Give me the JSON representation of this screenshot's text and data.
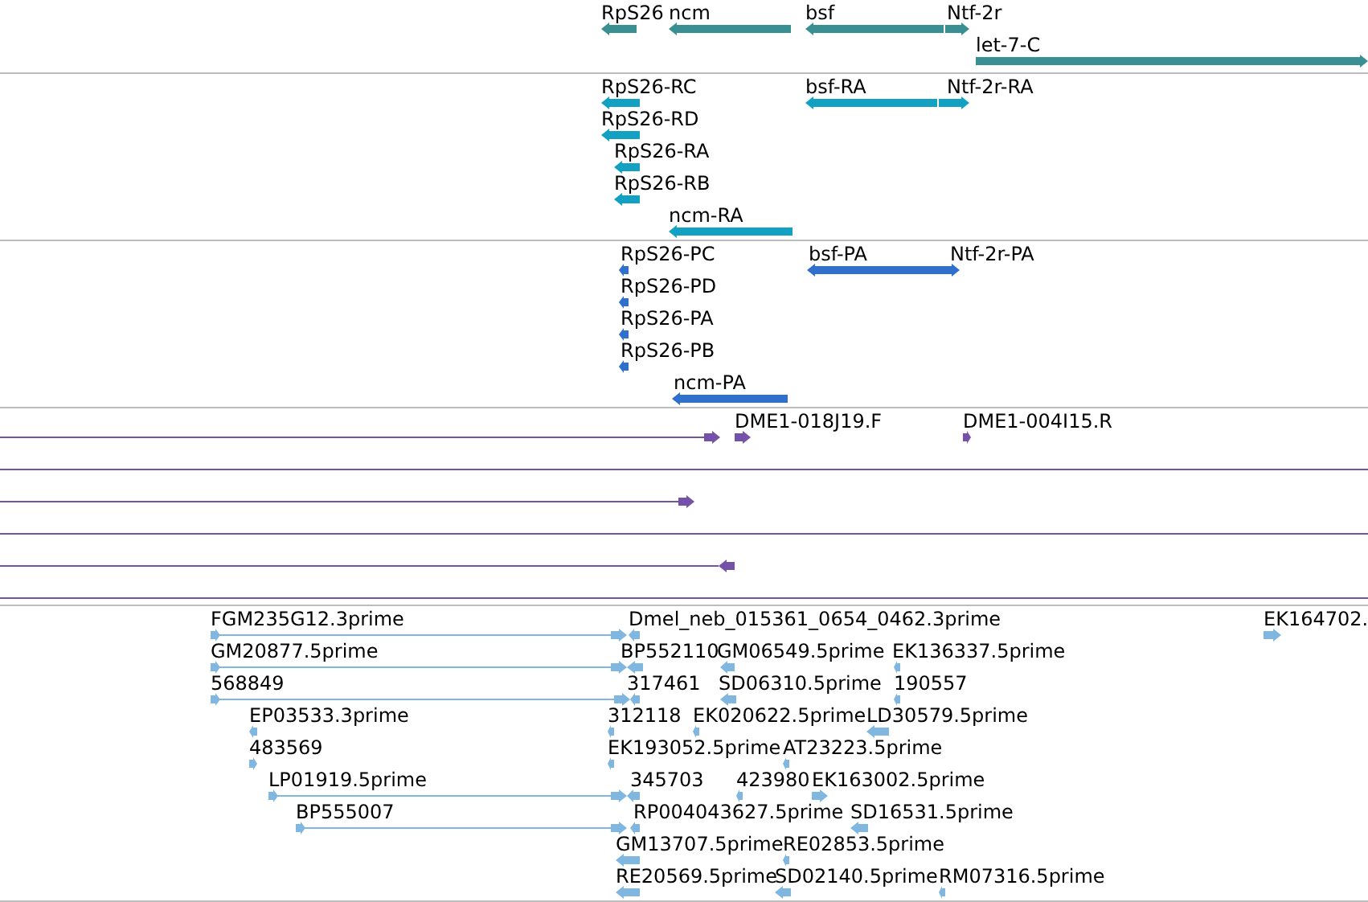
{
  "tracks": [
    {
      "kind": "gene",
      "features": [
        {
          "label": "RpS26",
          "kind": "block",
          "reverse": true
        },
        {
          "label": "ncm",
          "kind": "block",
          "reverse": true
        },
        {
          "label": "bsf",
          "kind": "block",
          "reverse": true
        },
        {
          "label": "Ntf-2r",
          "kind": "block",
          "reverse": false
        },
        {
          "label": "let-7-C",
          "kind": "block",
          "reverse": false
        }
      ]
    },
    {
      "kind": "transcript",
      "features": [
        {
          "label": "RpS26-RC",
          "kind": "block",
          "reverse": true
        },
        {
          "label": "RpS26-RD",
          "kind": "block",
          "reverse": true
        },
        {
          "label": "RpS26-RA",
          "kind": "block",
          "reverse": true
        },
        {
          "label": "RpS26-RB",
          "kind": "block",
          "reverse": true
        },
        {
          "label": "ncm-RA",
          "kind": "block",
          "reverse": true
        },
        {
          "label": "bsf-RA",
          "kind": "block",
          "reverse": true
        },
        {
          "label": "Ntf-2r-RA",
          "kind": "block",
          "reverse": false
        }
      ]
    },
    {
      "kind": "protein",
      "features": [
        {
          "label": "RpS26-PC",
          "kind": "block",
          "reverse": true
        },
        {
          "label": "RpS26-PD",
          "kind": "block",
          "reverse": true
        },
        {
          "label": "RpS26-PA",
          "kind": "block",
          "reverse": true
        },
        {
          "label": "RpS26-PB",
          "kind": "block",
          "reverse": true
        },
        {
          "label": "ncm-PA",
          "kind": "block",
          "reverse": true
        },
        {
          "label": "bsf-PA",
          "kind": "block",
          "reverse": true
        },
        {
          "label": "Ntf-2r-PA",
          "kind": "block",
          "reverse": false
        }
      ]
    },
    {
      "kind": "clone",
      "features": [
        {
          "kind": "line",
          "reverse": false
        },
        {
          "label": "DME1-018J19.F",
          "kind": "block",
          "reverse": false
        },
        {
          "label": "DME1-004I15.R",
          "kind": "block",
          "reverse": false
        },
        {
          "kind": "span"
        },
        {
          "kind": "line",
          "reverse": false
        },
        {
          "kind": "span"
        },
        {
          "kind": "line",
          "reverse": true
        },
        {
          "kind": "span"
        }
      ]
    },
    {
      "kind": "est",
      "features": [
        {
          "label": "FGM235G12.3prime",
          "kind": "line",
          "reverse": false
        },
        {
          "label": "Dmel_neb_015361_0654_0462.3prime",
          "kind": "block",
          "reverse": true
        },
        {
          "label": "EK164702.",
          "kind": "block",
          "reverse": false
        },
        {
          "label": "GM20877.5prime",
          "kind": "line",
          "reverse": false
        },
        {
          "label": "BP552110",
          "kind": "block",
          "reverse": true
        },
        {
          "label": "GM06549.5prime",
          "kind": "block",
          "reverse": true
        },
        {
          "label": "EK136337.5prime",
          "kind": "block",
          "reverse": true
        },
        {
          "label": "568849",
          "kind": "line",
          "reverse": false
        },
        {
          "label": "317461",
          "kind": "block",
          "reverse": true
        },
        {
          "label": "SD06310.5prime",
          "kind": "block",
          "reverse": true
        },
        {
          "label": "190557",
          "kind": "block",
          "reverse": true
        },
        {
          "label": "EP03533.3prime",
          "kind": "block",
          "reverse": true
        },
        {
          "label": "312118",
          "kind": "block",
          "reverse": true
        },
        {
          "label": "EK020622.5prime",
          "kind": "block",
          "reverse": true
        },
        {
          "label": "LD30579.5prime",
          "kind": "block",
          "reverse": true
        },
        {
          "label": "483569",
          "kind": "block",
          "reverse": false
        },
        {
          "label": "EK193052.5prime",
          "kind": "block",
          "reverse": true
        },
        {
          "label": "AT23223.5prime",
          "kind": "block",
          "reverse": true
        },
        {
          "label": "LP01919.5prime",
          "kind": "line",
          "reverse": false
        },
        {
          "label": "345703",
          "kind": "block",
          "reverse": true
        },
        {
          "label": "423980",
          "kind": "block",
          "reverse": true
        },
        {
          "label": "EK163002.5prime",
          "kind": "block",
          "reverse": false
        },
        {
          "label": "BP555007",
          "kind": "line",
          "reverse": false
        },
        {
          "label": "RP004043627.5prime",
          "kind": "block",
          "reverse": true
        },
        {
          "label": "SD16531.5prime",
          "kind": "block",
          "reverse": true
        },
        {
          "label": "GM13707.5prime",
          "kind": "block",
          "reverse": true
        },
        {
          "label": "RE02853.5prime",
          "kind": "block",
          "reverse": true
        },
        {
          "label": "RE20569.5prime",
          "kind": "block",
          "reverse": true
        },
        {
          "label": "SD02140.5prime",
          "kind": "block",
          "reverse": true
        },
        {
          "label": "RM07316.5prime",
          "kind": "block",
          "reverse": true
        }
      ]
    }
  ]
}
